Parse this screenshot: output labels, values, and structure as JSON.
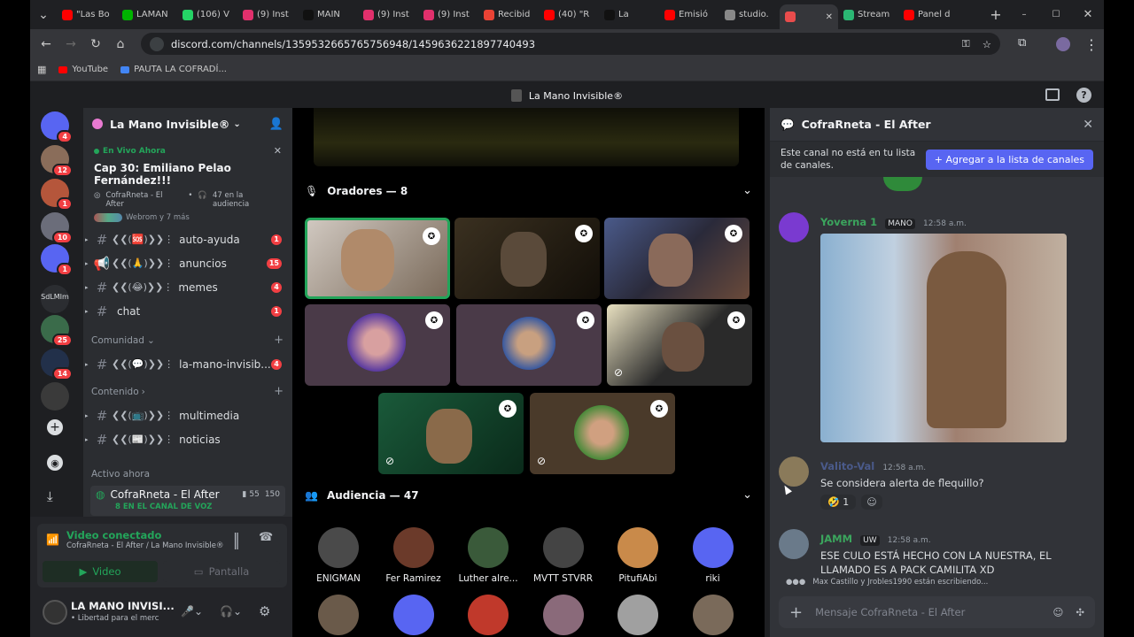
{
  "browser": {
    "tabs": [
      {
        "label": "\"Las Bo",
        "color": "#ff0000"
      },
      {
        "label": "LAMAN",
        "color": "#00b300"
      },
      {
        "label": "(106) V",
        "color": "#25d366"
      },
      {
        "label": "(9) Inst",
        "color": "#e1306c"
      },
      {
        "label": "MAIN",
        "color": "#111111"
      },
      {
        "label": "(9) Inst",
        "color": "#e1306c"
      },
      {
        "label": "(9) Inst",
        "color": "#e1306c"
      },
      {
        "label": "Recibid",
        "color": "#ea4335"
      },
      {
        "label": "(40) \"R",
        "color": "#ff0000"
      },
      {
        "label": "La",
        "color": "#111111"
      },
      {
        "label": "Emisió",
        "color": "#ff0000"
      },
      {
        "label": "studio.",
        "color": "#888888"
      },
      {
        "label": "",
        "color": "#e94c4c"
      },
      {
        "label": "Stream",
        "color": "#2bb673"
      },
      {
        "label": "Panel d",
        "color": "#ff0000"
      }
    ],
    "url": "discord.com/channels/1359532665765756948/1459636221897740493",
    "bookmarks": [
      {
        "label": "YouTube",
        "color": "#ff0000"
      },
      {
        "label": "PAUTA LA COFRADÍ...",
        "color": "#4285f4"
      }
    ]
  },
  "window_title": "La Mano Invisible®",
  "server": {
    "name": "La Mano Invisible®",
    "live_tag": "En Vivo Ahora",
    "live_title": "Cap 30: Emiliano Pelao Fernández!!!",
    "live_channel": "CofraRneta - El After",
    "live_audience": "47 en la audiencia",
    "live_more": "Webrom y 7 más",
    "channels": [
      {
        "deco": "❮❮(🆘)❯❯⋮",
        "name": "auto-ayuda",
        "badge": "1",
        "icon": "#"
      },
      {
        "deco": "❮❮(🙏)❯❯⋮",
        "name": "anuncios",
        "badge": "15",
        "icon": "📢"
      },
      {
        "deco": "❮❮(😂)❯❯⋮",
        "name": "memes",
        "badge": "4",
        "icon": "#"
      },
      {
        "deco": "",
        "name": "chat",
        "badge": "1",
        "icon": "#"
      }
    ],
    "cat_comunidad": "Comunidad",
    "comunidad_channels": [
      {
        "deco": "❮❮(💬)❯❯⋮",
        "name": "la-mano-invisib...",
        "badge": "4"
      }
    ],
    "cat_contenido": "Contenido",
    "contenido_channels": [
      {
        "deco": "❮❮(📺)❯❯⋮",
        "name": "multimedia"
      },
      {
        "deco": "❮❮(📰)❯❯⋮",
        "name": "noticias"
      }
    ],
    "active_label": "Activo ahora",
    "active_channel": "CofraRneta - El After",
    "active_count_a": "55",
    "active_count_b": "150",
    "active_sub": "8 EN EL CANAL DE VOZ"
  },
  "rail": [
    {
      "color": "#5865f2",
      "badge": "4"
    },
    {
      "color": "#8a6d5a",
      "badge": "12"
    },
    {
      "color": "#b5563b",
      "badge": "1"
    },
    {
      "color": "#6b6d7a",
      "badge": "10"
    },
    {
      "color": "#5865f2",
      "badge": "1"
    },
    {
      "color": "#2b2d31",
      "badge": "",
      "text": "SdLMIm"
    },
    {
      "color": "#3a6b4a",
      "badge": "25"
    },
    {
      "color": "#22304a",
      "badge": "14"
    },
    {
      "color": "#3a3a3a",
      "badge": ""
    }
  ],
  "user_panel": {
    "video_status": "Video conectado",
    "video_sub": "CofraRneta - El After / La Mano Invisible®",
    "video_btn": "Video",
    "screen_btn": "Pantalla",
    "username": "LA MANO INVISI...",
    "user_status": "• Libertad para el merc"
  },
  "stage": {
    "speakers_label": "Oradores — 8",
    "audience_label": "Audiencia — 47",
    "audience": [
      {
        "name": "ENIGMAN",
        "color": "#4a4a4a"
      },
      {
        "name": "Fer Ramirez",
        "color": "#6b3a2a"
      },
      {
        "name": "Luther alre...",
        "color": "#3a5a3a"
      },
      {
        "name": "MVTT STVRR",
        "color": "#444444"
      },
      {
        "name": "PitufiAbi",
        "color": "#c98a4a"
      },
      {
        "name": "riki",
        "color": "#5865f2"
      }
    ],
    "audience_row2": [
      "#6a5a4a",
      "#5865f2",
      "#c0392b",
      "#8a6a7a",
      "#a0a0a0",
      "#7a6a5a"
    ]
  },
  "right": {
    "title": "CofraRneta - El After",
    "notice": "Este canal no está en tu lista de canales.",
    "add_button": "Agregar a la lista de canales",
    "messages": [
      {
        "user": "Yoverna 1",
        "tag": "MANO",
        "time": "12:58 a.m.",
        "text": "",
        "color": "#3ba55d"
      },
      {
        "user": "Valito-Val",
        "tag": "",
        "time": "12:58 a.m.",
        "text": "Se considera alerta de flequillo?",
        "color": "#7a8aa0"
      },
      {
        "user": "JAMM",
        "tag": "UW",
        "time": "12:58 a.m.",
        "text": "ESE CULO ESTÁ HECHO CON LA NUESTRA, EL LLAMADO ES A PACK CAMILITA XD",
        "color": "#3ba55d"
      }
    ],
    "reaction_count": "1",
    "typing": "Max Castillo y Jrobles1990 están escribiendo...",
    "composer_placeholder": "Mensaje CofraRneta - El After"
  }
}
